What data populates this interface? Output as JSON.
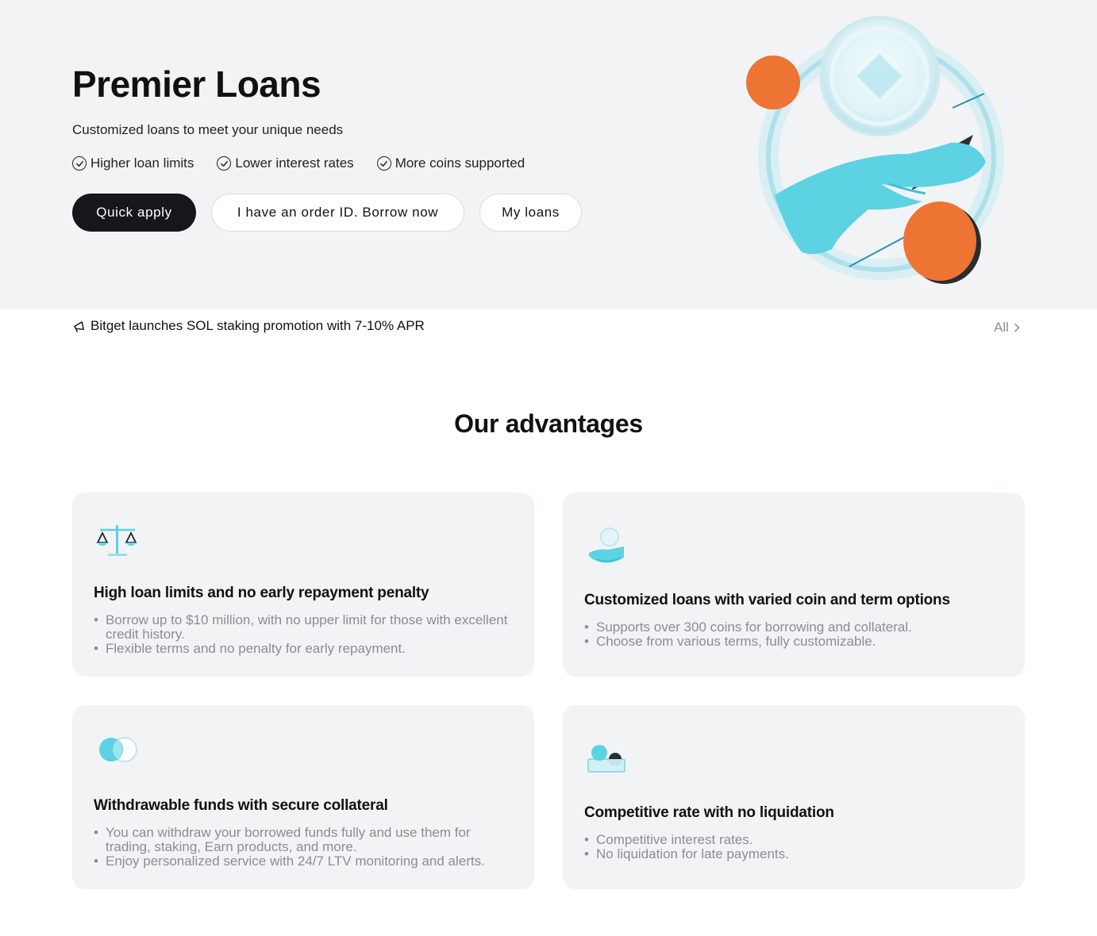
{
  "hero": {
    "title": "Premier Loans",
    "subtitle": "Customized loans to meet your unique needs",
    "features": [
      "Higher loan limits",
      "Lower interest rates",
      "More coins supported"
    ],
    "buttons": {
      "quick_apply": "Quick apply",
      "borrow_now": "I have an order ID. Borrow now",
      "my_loans": "My loans"
    }
  },
  "announcement": {
    "text": "Bitget launches SOL staking promotion with 7-10% APR",
    "all_label": "All"
  },
  "advantages": {
    "title": "Our advantages",
    "cards": [
      {
        "icon": "scales-icon",
        "title": "High loan limits and no early repayment penalty",
        "points": [
          "Borrow up to $10 million, with no upper limit for those with excellent credit history.",
          "Flexible terms and no penalty for early repayment."
        ]
      },
      {
        "icon": "hand-coin-icon",
        "title": "Customized loans with varied coin and term options",
        "points": [
          "Supports over 300 coins for borrowing and collateral.",
          "Choose from various terms, fully customizable."
        ]
      },
      {
        "icon": "overlapping-circles-icon",
        "title": "Withdrawable funds with secure collateral",
        "points": [
          "You can withdraw your borrowed funds fully and use them for trading, staking, Earn products, and more.",
          "Enjoy personalized service with 24/7 LTV monitoring and alerts."
        ]
      },
      {
        "icon": "coins-tray-icon",
        "title": "Competitive rate with no liquidation",
        "points": [
          "Competitive interest rates.",
          "No liquidation for late payments."
        ]
      }
    ]
  },
  "colors": {
    "hero_bg": "#f2f3f5",
    "primary_button": "#15171a",
    "accent_cyan": "#5cd2e3",
    "accent_orange": "#ee7433",
    "muted_text": "#8a8d93"
  }
}
